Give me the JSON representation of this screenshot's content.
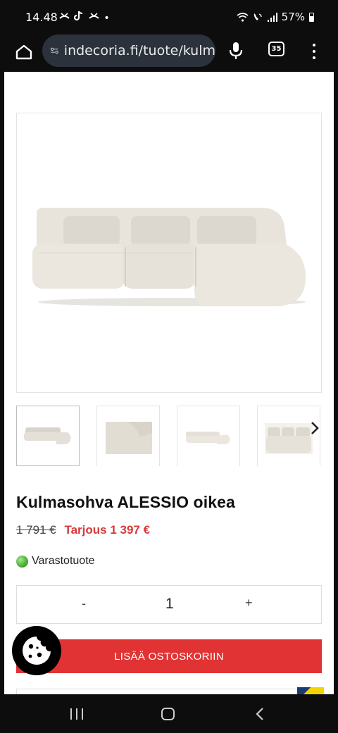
{
  "status_bar": {
    "time": "14.48",
    "notification_icons": [
      "missed-call-icon",
      "tiktok-icon",
      "missed-call-icon"
    ],
    "dot": "•",
    "battery": "57%"
  },
  "browser": {
    "url": "indecoria.fi/tuote/kulm",
    "tab_count": "35"
  },
  "product": {
    "title": "Kulmasohva ALESSIO oikea",
    "old_price": "1 791 €",
    "sale_price": "Tarjous 1 397 €",
    "stock_status": "Varastotuote",
    "quantity": "1",
    "qty_minus": "-",
    "qty_plus": "+",
    "add_to_cart": "LISÄÄ OSTOSKORIIN",
    "thumbnail_count": 4,
    "selected_thumbnail": 1
  },
  "colors": {
    "sale": "#d63a3a",
    "cart_button": "#e13333",
    "in_stock": "#3aa326",
    "url_pill": "#2b323b"
  }
}
